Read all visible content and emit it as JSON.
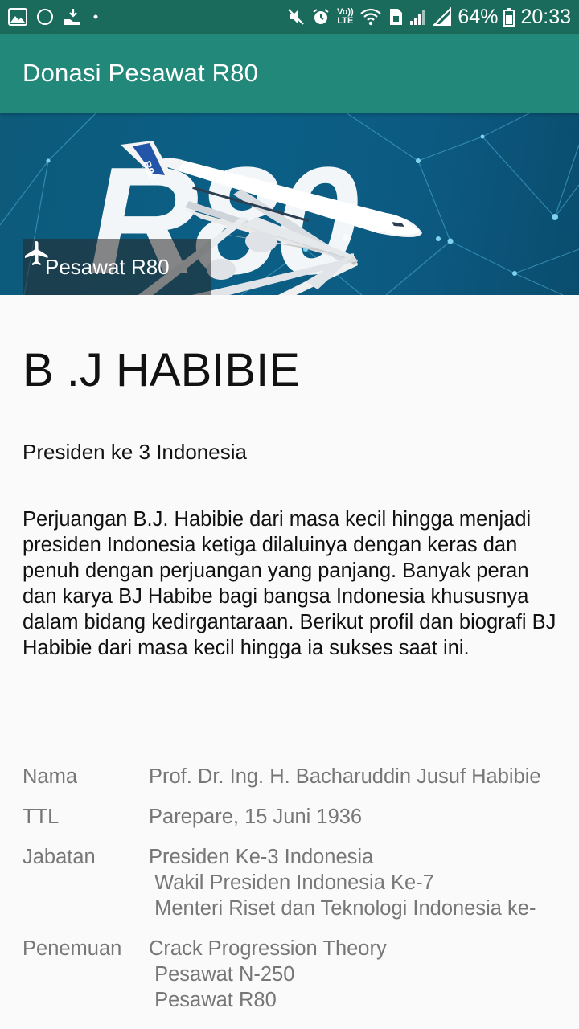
{
  "status_bar": {
    "battery": "64%",
    "time": "20:33",
    "volte": "Vo)) LTE"
  },
  "app_bar": {
    "title": "Donasi Pesawat R80"
  },
  "hero": {
    "big_text": "R80",
    "tail_text": "R80",
    "chip_label": "Pesawat R80",
    "chip_icon": "airplane-icon"
  },
  "content": {
    "title": "B .J HABIBIE",
    "subtitle": "Presiden ke 3 Indonesia",
    "description": "Perjuangan B.J. Habibie dari masa kecil hingga menjadi presiden Indonesia ketiga dilaluinya dengan keras dan penuh dengan perjuangan yang panjang. Banyak peran dan karya BJ Habibe bagi bangsa Indonesia khususnya dalam bidang kedirgantaraan. Berikut profil dan biografi BJ Habibie dari masa kecil hingga ia sukses saat ini."
  },
  "info": [
    {
      "key": "Nama",
      "value": "Prof. Dr. Ing. H. Bacharuddin Jusuf Habibie"
    },
    {
      "key": "TTL",
      "value": "Parepare, 15 Juni 1936"
    },
    {
      "key": "Jabatan",
      "value": "Presiden Ke-3 Indonesia\n Wakil Presiden Indonesia Ke-7\n Menteri Riset dan Teknologi Indonesia ke-"
    },
    {
      "key": "Penemuan",
      "value": "Crack Progression Theory\n Pesawat N-250\n Pesawat R80"
    }
  ]
}
